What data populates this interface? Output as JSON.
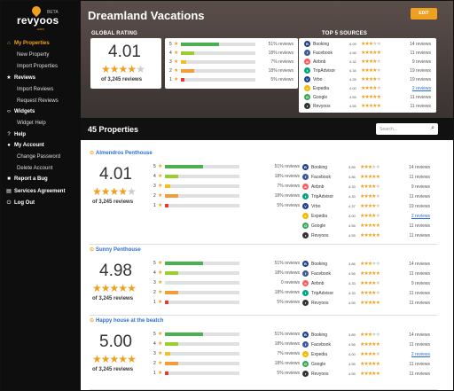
{
  "sidebar": {
    "brand": "revyoos",
    "beta": "BETA",
    "domain": ".com",
    "items": [
      {
        "key": "my-properties",
        "icon": "⌂",
        "label": "My Properties",
        "level": 0,
        "active": true
      },
      {
        "key": "new-property",
        "label": "New Property",
        "level": 1
      },
      {
        "key": "import-properties",
        "label": "Import Properties",
        "level": 1
      },
      {
        "key": "reviews",
        "icon": "★",
        "label": "Reviews",
        "level": 0
      },
      {
        "key": "import-reviews",
        "label": "Import Reviews",
        "level": 1
      },
      {
        "key": "request-reviews",
        "label": "Request Reviews",
        "level": 1
      },
      {
        "key": "widgets",
        "icon": "‹›",
        "label": "Widgets",
        "level": 0
      },
      {
        "key": "widget-help",
        "label": "Widget Help",
        "level": 1
      },
      {
        "key": "help",
        "icon": "?",
        "label": "Help",
        "level": 0
      },
      {
        "key": "my-account",
        "icon": "●",
        "label": "My Account",
        "level": 0
      },
      {
        "key": "change-password",
        "label": "Change Password",
        "level": 1
      },
      {
        "key": "delete-account",
        "label": "Delete Account",
        "level": 1
      },
      {
        "key": "report-bug",
        "icon": "■",
        "label": "Report a Bug",
        "level": 0
      },
      {
        "key": "services-agreement",
        "icon": "▤",
        "label": "Services Agreement",
        "level": 0
      },
      {
        "key": "log-out",
        "icon": "⏻",
        "label": "Log Out",
        "level": 0
      }
    ]
  },
  "header": {
    "title": "Dreamland Vacations",
    "edit_label": "EDIT",
    "global_rating_label": "GLOBAL RATING",
    "top_sources_label": "TOP 5 SOURCES"
  },
  "global": {
    "score": "4.01",
    "stars": 4,
    "count": "of 3,245 reviews",
    "breakdown": [
      {
        "stars": "5",
        "pct": 51,
        "label": "51% reviews",
        "color": "#4caf50"
      },
      {
        "stars": "4",
        "pct": 18,
        "label": "18% reviews",
        "color": "#9acd32"
      },
      {
        "stars": "3",
        "pct": 7,
        "label": "7% reviews",
        "color": "#f0c020"
      },
      {
        "stars": "2",
        "pct": 18,
        "label": "18% reviews",
        "color": "#f39c3c"
      },
      {
        "stars": "1",
        "pct": 5,
        "label": "5% reviews",
        "color": "#e53935"
      }
    ],
    "sources": [
      {
        "name": "Booking",
        "color": "#1f3f8a",
        "letter": "B",
        "score": "4.09",
        "stars": 3,
        "count": "14 reviews"
      },
      {
        "name": "Facebook",
        "color": "#3b5998",
        "letter": "f",
        "score": "4.56",
        "stars": 5,
        "count": "11 reviews"
      },
      {
        "name": "Airbnb",
        "color": "#ff5a5f",
        "letter": "a",
        "score": "4.32",
        "stars": 4,
        "count": "9 reviews"
      },
      {
        "name": "TripAdvisor",
        "color": "#00a680",
        "letter": "t",
        "score": "4.34",
        "stars": 4,
        "count": "19 reviews"
      },
      {
        "name": "Vrbo",
        "color": "#1c3d8c",
        "letter": "V",
        "score": "4.25",
        "stars": 4,
        "count": "19 reviews"
      },
      {
        "name": "Expedia",
        "color": "#f5b800",
        "letter": "e",
        "score": "4.00",
        "stars": 4,
        "count": "2 reviews",
        "link": true
      },
      {
        "name": "Google",
        "color": "#34a853",
        "letter": "G",
        "score": "4.55",
        "stars": 5,
        "count": "11 reviews"
      },
      {
        "name": "Revyoos",
        "color": "#333333",
        "letter": "r",
        "score": "4.55",
        "stars": 5,
        "count": "11 reviews"
      }
    ]
  },
  "properties_bar": {
    "title": "45 Properties",
    "search_placeholder": "Search..."
  },
  "properties": [
    {
      "name": "Almendros Penthouse",
      "score": "4.01",
      "stars": 4,
      "count": "of 3,245 reviews",
      "breakdown": [
        {
          "stars": "5",
          "pct": 51,
          "label": "51% reviews",
          "color": "#4caf50"
        },
        {
          "stars": "4",
          "pct": 18,
          "label": "18% reviews",
          "color": "#9acd32"
        },
        {
          "stars": "3",
          "pct": 7,
          "label": "7% reviews",
          "color": "#f0c020"
        },
        {
          "stars": "2",
          "pct": 18,
          "label": "18% reviews",
          "color": "#f39c3c"
        },
        {
          "stars": "1",
          "pct": 5,
          "label": "5% reviews",
          "color": "#e53935"
        }
      ],
      "sources": [
        {
          "name": "Booking",
          "color": "#1f3f8a",
          "letter": "B",
          "score": "3.89",
          "stars": 3,
          "count": "14 reviews"
        },
        {
          "name": "Facebook",
          "color": "#3b5998",
          "letter": "f",
          "score": "4.86",
          "stars": 5,
          "count": "11 reviews"
        },
        {
          "name": "Airbnb",
          "color": "#ff5a5f",
          "letter": "a",
          "score": "4.33",
          "stars": 4,
          "count": "9 reviews"
        },
        {
          "name": "TripAdvisor",
          "color": "#00a680",
          "letter": "t",
          "score": "4.33",
          "stars": 4,
          "count": "11 reviews"
        },
        {
          "name": "Vrbo",
          "color": "#1c3d8c",
          "letter": "V",
          "score": "4.37",
          "stars": 4,
          "count": "19 reviews"
        },
        {
          "name": "Expedia",
          "color": "#f5b800",
          "letter": "e",
          "score": "4.00",
          "stars": 4,
          "count": "2 reviews",
          "link": true
        },
        {
          "name": "Google",
          "color": "#34a853",
          "letter": "G",
          "score": "4.55",
          "stars": 5,
          "count": "11 reviews"
        },
        {
          "name": "Revyoos",
          "color": "#333333",
          "letter": "r",
          "score": "4.55",
          "stars": 5,
          "count": "11 reviews"
        }
      ]
    },
    {
      "name": "Sunny Penthouse",
      "score": "4.98",
      "stars": 5,
      "count": "of 3,245 reviews",
      "breakdown": [
        {
          "stars": "5",
          "pct": 51,
          "label": "51% reviews",
          "color": "#4caf50"
        },
        {
          "stars": "4",
          "pct": 18,
          "label": "18% reviews",
          "color": "#9acd32"
        },
        {
          "stars": "3",
          "pct": 0,
          "label": "0 reviews",
          "color": "#f0c020"
        },
        {
          "stars": "2",
          "pct": 18,
          "label": "18% reviews",
          "color": "#f39c3c"
        },
        {
          "stars": "1",
          "pct": 5,
          "label": "5% reviews",
          "color": "#e53935"
        }
      ],
      "sources": [
        {
          "name": "Booking",
          "color": "#1f3f8a",
          "letter": "B",
          "score": "3.86",
          "stars": 3,
          "count": "14 reviews"
        },
        {
          "name": "Facebook",
          "color": "#3b5998",
          "letter": "f",
          "score": "4.56",
          "stars": 5,
          "count": "11 reviews"
        },
        {
          "name": "Airbnb",
          "color": "#ff5a5f",
          "letter": "a",
          "score": "4.33",
          "stars": 4,
          "count": "9 reviews"
        },
        {
          "name": "TripAdvisor",
          "color": "#00a680",
          "letter": "t",
          "score": "4.33",
          "stars": 4,
          "count": "11 reviews"
        },
        {
          "name": "Revyoos",
          "color": "#333333",
          "letter": "r",
          "score": "4.55",
          "stars": 5,
          "count": "11 reviews"
        }
      ]
    },
    {
      "name": "Happy house at the beatch",
      "score": "5.00",
      "stars": 5,
      "count": "of 3,245 reviews",
      "breakdown": [
        {
          "stars": "5",
          "pct": 51,
          "label": "51% reviews",
          "color": "#4caf50"
        },
        {
          "stars": "4",
          "pct": 18,
          "label": "18% reviews",
          "color": "#9acd32"
        },
        {
          "stars": "3",
          "pct": 7,
          "label": "7% reviews",
          "color": "#f0c020"
        },
        {
          "stars": "2",
          "pct": 18,
          "label": "18% reviews",
          "color": "#f39c3c"
        },
        {
          "stars": "1",
          "pct": 5,
          "label": "5% reviews",
          "color": "#e53935"
        }
      ],
      "sources": [
        {
          "name": "Booking",
          "color": "#1f3f8a",
          "letter": "B",
          "score": "3.89",
          "stars": 3,
          "count": "14 reviews"
        },
        {
          "name": "Facebook",
          "color": "#3b5998",
          "letter": "f",
          "score": "4.56",
          "stars": 5,
          "count": "11 reviews"
        },
        {
          "name": "Expedia",
          "color": "#f5b800",
          "letter": "e",
          "score": "4.00",
          "stars": 4,
          "count": "2 reviews",
          "link": true
        },
        {
          "name": "Google",
          "color": "#34a853",
          "letter": "G",
          "score": "4.55",
          "stars": 5,
          "count": "11 reviews"
        },
        {
          "name": "Revyoos",
          "color": "#333333",
          "letter": "r",
          "score": "4.55",
          "stars": 5,
          "count": "11 reviews"
        }
      ]
    }
  ]
}
